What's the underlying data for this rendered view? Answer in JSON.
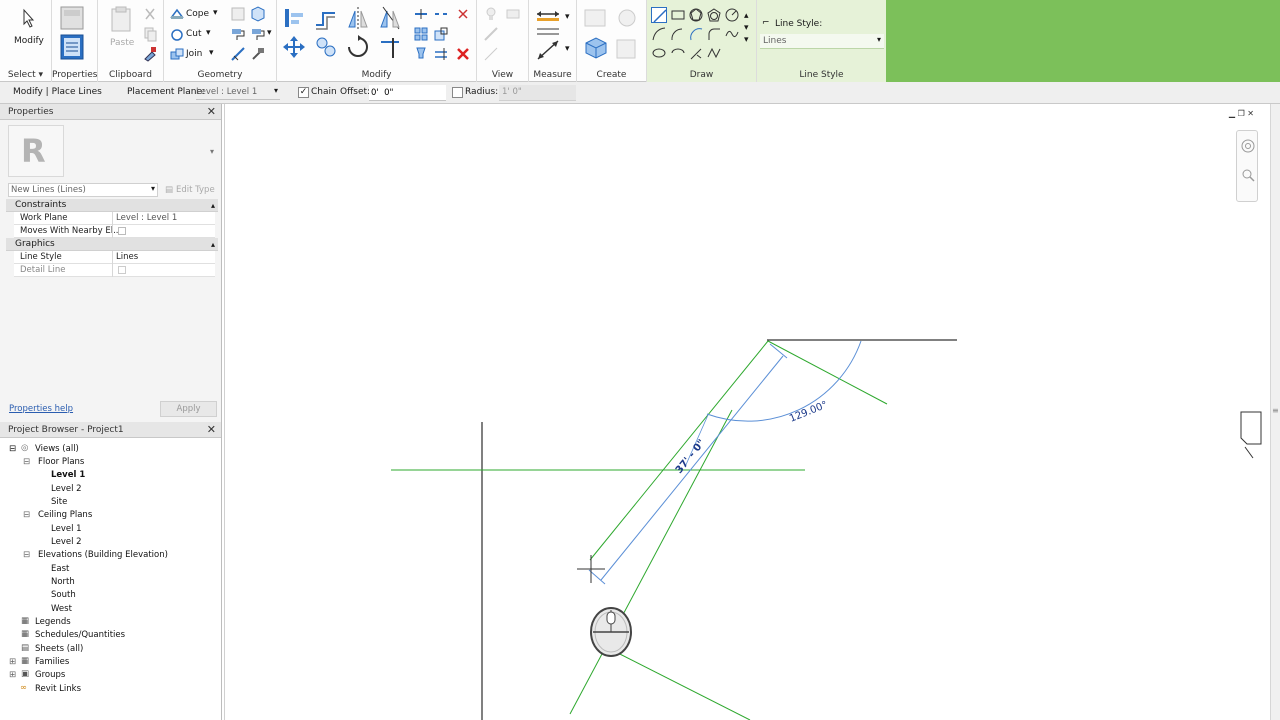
{
  "ribbon": {
    "select_label": "Select",
    "select_menu": "Select ▾",
    "modify_label": "Modify",
    "groups": {
      "properties": "Properties",
      "clipboard": "Clipboard",
      "geometry": "Geometry",
      "modify": "Modify",
      "view": "View",
      "measure": "Measure",
      "create": "Create",
      "draw": "Draw",
      "line_style": "Line Style"
    },
    "paste_label": "Paste",
    "cope_label": "Cope",
    "cut_label": "Cut",
    "join_label": "Join",
    "line_style_label": "Line Style:",
    "line_style_value": "Lines"
  },
  "options_bar": {
    "context": "Modify | Place Lines",
    "placement_plane_label": "Placement Plane:",
    "placement_plane_value": "Level : Level 1",
    "chain_label": "Chain",
    "chain_checked": true,
    "offset_label": "Offset:",
    "offset_value": "0'  0\"",
    "radius_label": "Radius:",
    "radius_value": "1'  0\""
  },
  "properties": {
    "title": "Properties",
    "type_selector": "New Lines (Lines)",
    "edit_type": "Edit Type",
    "sections": [
      {
        "name": "Constraints",
        "rows": [
          {
            "key": "Work Plane",
            "value": "Level : Level 1"
          },
          {
            "key": "Moves With Nearby El...",
            "value": ""
          }
        ]
      },
      {
        "name": "Graphics",
        "rows": [
          {
            "key": "Line Style",
            "value": "Lines"
          },
          {
            "key": "Detail Line",
            "value": ""
          }
        ]
      }
    ],
    "help_link": "Properties help",
    "apply_button": "Apply"
  },
  "project_browser": {
    "title": "Project Browser - Project1",
    "views_all": "Views (all)",
    "floor_plans": "Floor Plans",
    "fp_level1": "Level 1",
    "fp_level2": "Level 2",
    "fp_site": "Site",
    "ceiling_plans": "Ceiling Plans",
    "cp_level1": "Level 1",
    "cp_level2": "Level 2",
    "elevations": "Elevations (Building Elevation)",
    "east": "East",
    "north": "North",
    "south": "South",
    "west": "West",
    "legends": "Legends",
    "schedules": "Schedules/Quantities",
    "sheets": "Sheets (all)",
    "families": "Families",
    "groups": "Groups",
    "revit_links": "Revit Links"
  },
  "canvas": {
    "angle_label": "129.00°",
    "length_label": "37' - 0\""
  },
  "colors": {
    "draw_group_bg": "#e6f2d8",
    "accent_green": "#7cc05a",
    "guide_green": "#2ea82e",
    "sketch_blue": "#5b8fd6",
    "link_blue": "#2a5db0"
  }
}
